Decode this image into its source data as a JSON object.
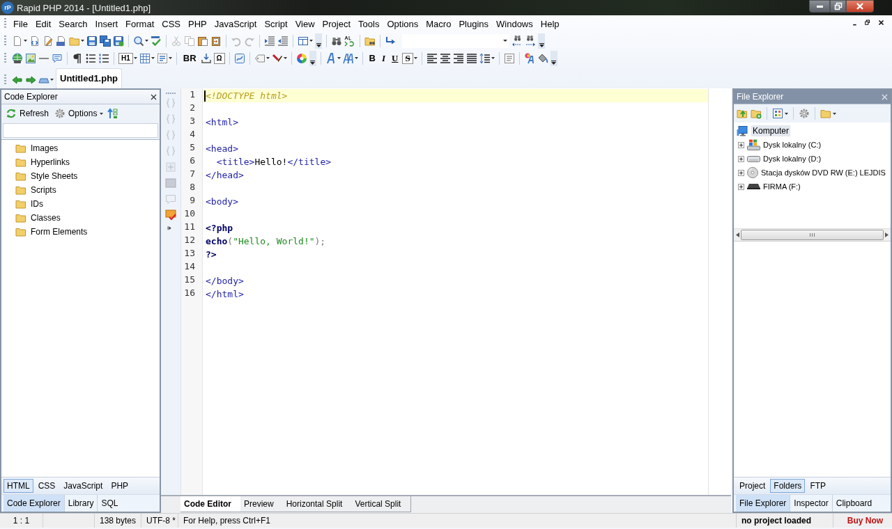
{
  "window": {
    "logo": "rP",
    "title": "Rapid PHP 2014 - [Untitled1.php]"
  },
  "menu": [
    {
      "label": "File"
    },
    {
      "label": "Edit"
    },
    {
      "label": "Search"
    },
    {
      "label": "Insert"
    },
    {
      "label": "Format"
    },
    {
      "label": "CSS"
    },
    {
      "label": "PHP"
    },
    {
      "label": "JavaScript"
    },
    {
      "label": "Script"
    },
    {
      "label": "View"
    },
    {
      "label": "Project"
    },
    {
      "label": "Tools"
    },
    {
      "label": "Options"
    },
    {
      "label": "Macro"
    },
    {
      "label": "Plugins"
    },
    {
      "label": "Windows"
    },
    {
      "label": "Help"
    }
  ],
  "format_toolbar": {
    "text_buttons": [
      {
        "label": "H1",
        "kind": "boxed"
      },
      {
        "label": "BR",
        "kind": "bold"
      },
      {
        "label": "Ω",
        "kind": "boxed"
      },
      {
        "label": "B",
        "kind": "bold"
      },
      {
        "label": "I",
        "kind": "italic"
      },
      {
        "label": "U",
        "kind": "underline"
      },
      {
        "label": "S",
        "kind": "strike"
      }
    ]
  },
  "document_tabs": [
    {
      "label": "Untitled1.php",
      "selected": true
    }
  ],
  "code_explorer": {
    "title": "Code Explorer",
    "toolbar": [
      {
        "label": "Refresh",
        "kind": "refresh"
      },
      {
        "label": "Options",
        "kind": "options"
      }
    ],
    "items": [
      {
        "label": "Images"
      },
      {
        "label": "Hyperlinks"
      },
      {
        "label": "Style Sheets"
      },
      {
        "label": "Scripts"
      },
      {
        "label": "IDs"
      },
      {
        "label": "Classes"
      },
      {
        "label": "Form Elements"
      }
    ],
    "language_tabs": [
      {
        "label": "HTML",
        "selected": true
      },
      {
        "label": "CSS",
        "selected": false
      },
      {
        "label": "JavaScript",
        "selected": false
      },
      {
        "label": "PHP",
        "selected": false
      }
    ],
    "panel_tabs": [
      {
        "label": "Code Explorer",
        "selected": true
      },
      {
        "label": "Library",
        "selected": false
      },
      {
        "label": "SQL",
        "selected": false
      }
    ]
  },
  "editor": {
    "lines": [
      {
        "number": "1",
        "current": true,
        "tokens": [
          {
            "kind": "doctype",
            "text": "<!DOCTYPE html>"
          }
        ]
      },
      {
        "number": "2",
        "current": false
      },
      {
        "number": "3",
        "current": false,
        "tokens": [
          {
            "kind": "tag",
            "text": "<html>"
          }
        ]
      },
      {
        "number": "4",
        "current": false
      },
      {
        "number": "5",
        "current": false,
        "tokens": [
          {
            "kind": "tag",
            "text": "<head>"
          }
        ]
      },
      {
        "number": "6",
        "current": false,
        "tokens": [
          {
            "kind": "tag",
            "text": "  <title>"
          },
          {
            "kind": "text",
            "text": "Hello!"
          },
          {
            "kind": "tag",
            "text": "</title>"
          }
        ]
      },
      {
        "number": "7",
        "current": false,
        "tokens": [
          {
            "kind": "tag",
            "text": "</head>"
          }
        ]
      },
      {
        "number": "8",
        "current": false
      },
      {
        "number": "9",
        "current": false,
        "tokens": [
          {
            "kind": "tag",
            "text": "<body>"
          }
        ]
      },
      {
        "number": "10",
        "current": false
      },
      {
        "number": "11",
        "current": false,
        "tokens": [
          {
            "kind": "php",
            "text": "<?php"
          }
        ]
      },
      {
        "number": "12",
        "current": false,
        "tokens": [
          {
            "kind": "php",
            "text": "echo"
          },
          {
            "kind": "punct",
            "text": "("
          },
          {
            "kind": "string",
            "text": "\"Hello, World!\""
          },
          {
            "kind": "punct",
            "text": ");"
          }
        ]
      },
      {
        "number": "13",
        "current": false,
        "tokens": [
          {
            "kind": "php",
            "text": "?>"
          }
        ]
      },
      {
        "number": "14",
        "current": false
      },
      {
        "number": "15",
        "current": false,
        "tokens": [
          {
            "kind": "tag",
            "text": "</body>"
          }
        ]
      },
      {
        "number": "16",
        "current": false,
        "tokens": [
          {
            "kind": "tag",
            "text": "</html>"
          }
        ]
      }
    ],
    "view_tabs": [
      {
        "label": "Code Editor",
        "selected": true
      },
      {
        "label": "Preview",
        "selected": false
      },
      {
        "label": "Horizontal Split",
        "selected": false
      },
      {
        "label": "Vertical Split",
        "selected": false
      }
    ]
  },
  "file_explorer": {
    "title": "File Explorer",
    "tree": [
      {
        "label": "Komputer",
        "kind": "computer",
        "selected": true,
        "children": [
          {
            "label": "Dysk lokalny (C:)",
            "kind": "system-drive",
            "selected": false,
            "expanded": false
          },
          {
            "label": "Dysk lokalny (D:)",
            "kind": "drive",
            "selected": false,
            "expanded": false
          },
          {
            "label": "Stacja dysków DVD RW (E:) LEJDIS",
            "kind": "dvd",
            "selected": false,
            "expanded": false
          },
          {
            "label": "FIRMA (F:)",
            "kind": "removable",
            "selected": false,
            "expanded": false
          }
        ]
      }
    ],
    "source_tabs": [
      {
        "label": "Project",
        "selected": false
      },
      {
        "label": "Folders",
        "selected": true
      },
      {
        "label": "FTP",
        "selected": false
      }
    ],
    "panel_tabs": [
      {
        "label": "File Explorer",
        "selected": true
      },
      {
        "label": "Inspector",
        "selected": false
      },
      {
        "label": "Clipboard",
        "selected": false
      }
    ]
  },
  "status_bar": {
    "fields": [
      {
        "text": "1 : 1"
      },
      {
        "text": "138 bytes"
      },
      {
        "text": "UTF-8 *"
      },
      {
        "text": "For Help, press Ctrl+F1"
      }
    ],
    "project": "no project loaded",
    "action": "Buy Now"
  }
}
